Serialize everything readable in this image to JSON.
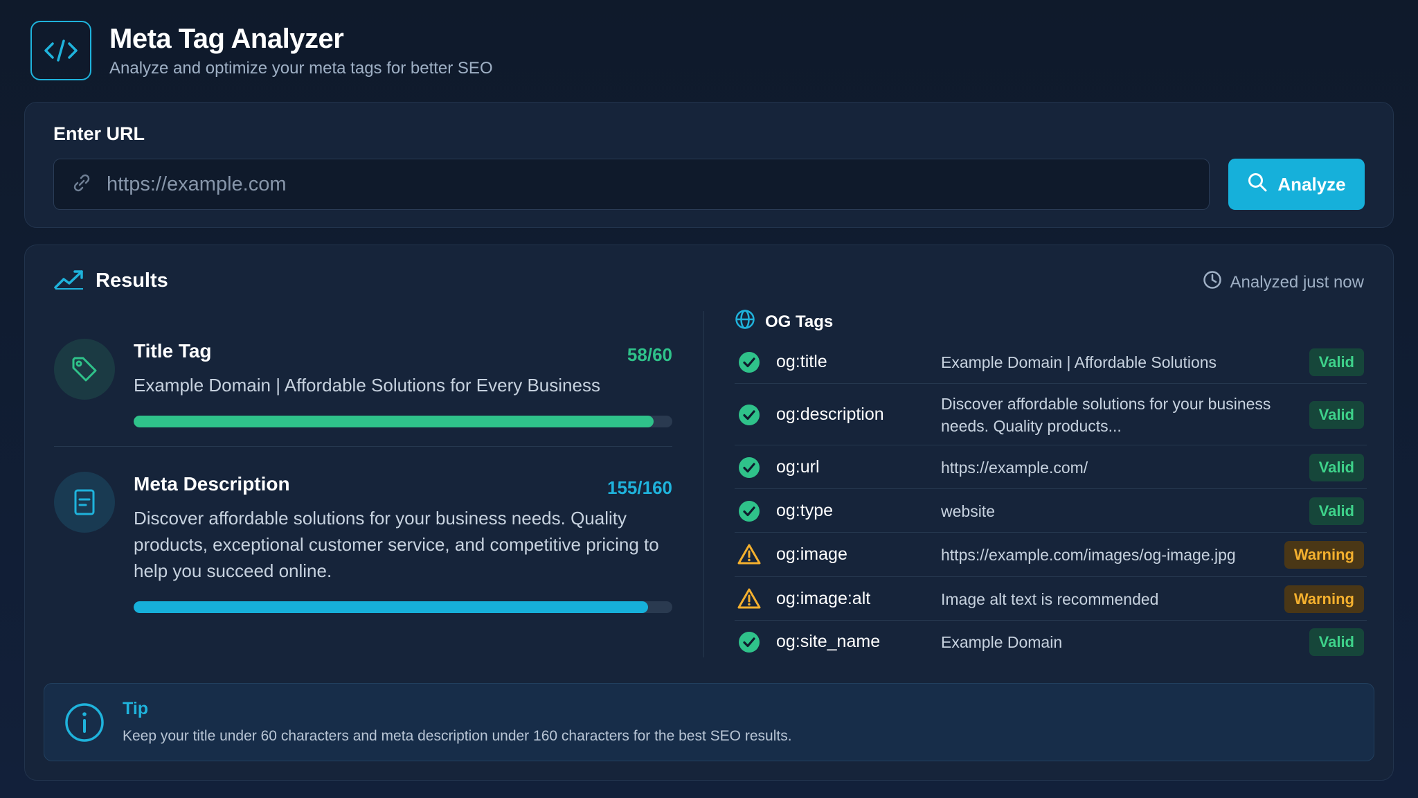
{
  "header": {
    "title": "Meta Tag Analyzer",
    "subtitle": "Analyze and optimize your meta tags for better SEO",
    "logo_icon": "code-icon"
  },
  "url_form": {
    "label": "Enter URL",
    "placeholder": "https://example.com",
    "value": "",
    "button_label": "Analyze"
  },
  "results": {
    "title": "Results",
    "analyzed_text": "Analyzed just now",
    "title_tag": {
      "name": "Title Tag",
      "count": "58/60",
      "value": "Example Domain | Affordable Solutions for Every Business",
      "progress": 0.965
    },
    "meta_description": {
      "name": "Meta Description",
      "count": "155/160",
      "value": "Discover affordable solutions for your business needs. Quality products, exceptional customer service, and competitive pricing to help you succeed online.",
      "progress": 0.955
    },
    "og": {
      "heading": "OG Tags",
      "rows": [
        {
          "key": "og:title",
          "value": "Example Domain | Affordable Solutions",
          "status": "Valid"
        },
        {
          "key": "og:description",
          "value": "Discover affordable solutions for your business needs. Quality products...",
          "status": "Valid"
        },
        {
          "key": "og:url",
          "value": "https://example.com/",
          "status": "Valid"
        },
        {
          "key": "og:type",
          "value": "website",
          "status": "Valid"
        },
        {
          "key": "og:image",
          "value": "https://example.com/images/og-image.jpg",
          "status": "Warning"
        },
        {
          "key": "og:image:alt",
          "value": "Image alt text is recommended",
          "status": "Warning"
        },
        {
          "key": "og:site_name",
          "value": "Example Domain",
          "status": "Valid"
        }
      ]
    },
    "tip": {
      "title": "Tip",
      "text": "Keep your title under 60 characters and meta description under 160 characters for the best SEO results."
    }
  },
  "colors": {
    "accent": "#16b0da",
    "green": "#2fc28a",
    "warning": "#f4b02e"
  }
}
